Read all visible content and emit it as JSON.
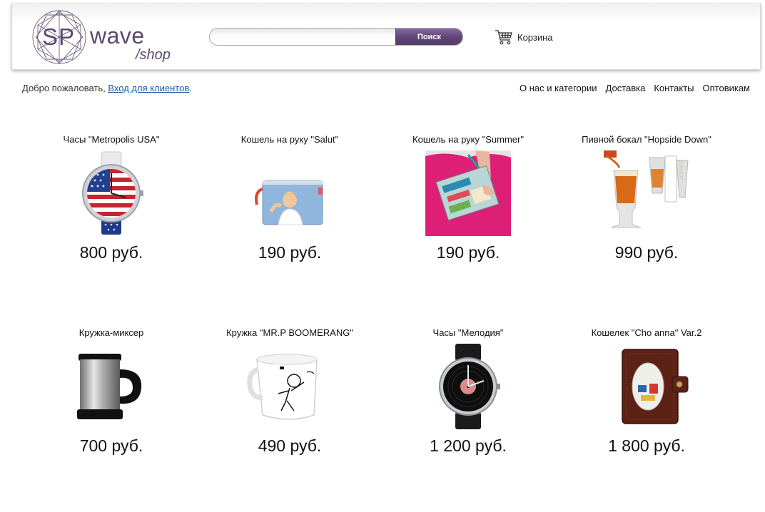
{
  "brand": {
    "logo_sp": "SP",
    "logo_wave": "wave",
    "logo_shop": "/shop"
  },
  "search": {
    "placeholder": "",
    "value": "",
    "button_label": "Поиск"
  },
  "cart": {
    "label": "Корзина",
    "icon": "cart-icon"
  },
  "welcome": {
    "text": "Добро пожаловать, ",
    "login_link": "Вход для клиентов",
    "suffix": "."
  },
  "nav": {
    "items": [
      {
        "label": "О нас и категории"
      },
      {
        "label": "Доставка"
      },
      {
        "label": "Контакты"
      },
      {
        "label": "Оптовикам"
      }
    ]
  },
  "products": [
    {
      "title": "Часы \"Metropolis USA\"",
      "price": "800 руб.",
      "image": "watch-usa-flag"
    },
    {
      "title": "Кошель на руку \"Salut\"",
      "price": "190 руб.",
      "image": "blue-pouch-wallet"
    },
    {
      "title": "Кошель на руку \"Summer\"",
      "price": "190 руб.",
      "image": "summer-clutch-photo"
    },
    {
      "title": "Пивной бокал \"Hopside Down\"",
      "price": "990 руб.",
      "image": "beer-glass"
    },
    {
      "title": "Кружка-миксер",
      "price": "700 руб.",
      "image": "steel-mixer-mug"
    },
    {
      "title": "Кружка \"MR.P BOOMERANG\"",
      "price": "490 руб.",
      "image": "white-boomerang-mug"
    },
    {
      "title": "Часы \"Мелодия\"",
      "price": "1 200 руб.",
      "image": "vinyl-record-watch"
    },
    {
      "title": "Кошелек \"Cho anna\" Var.2",
      "price": "1 800 руб.",
      "image": "brown-leather-wallet"
    }
  ],
  "colors": {
    "brand_purple": "#5d4a6e",
    "button_purple": "#5e4377",
    "link_blue": "#1a58a6"
  }
}
